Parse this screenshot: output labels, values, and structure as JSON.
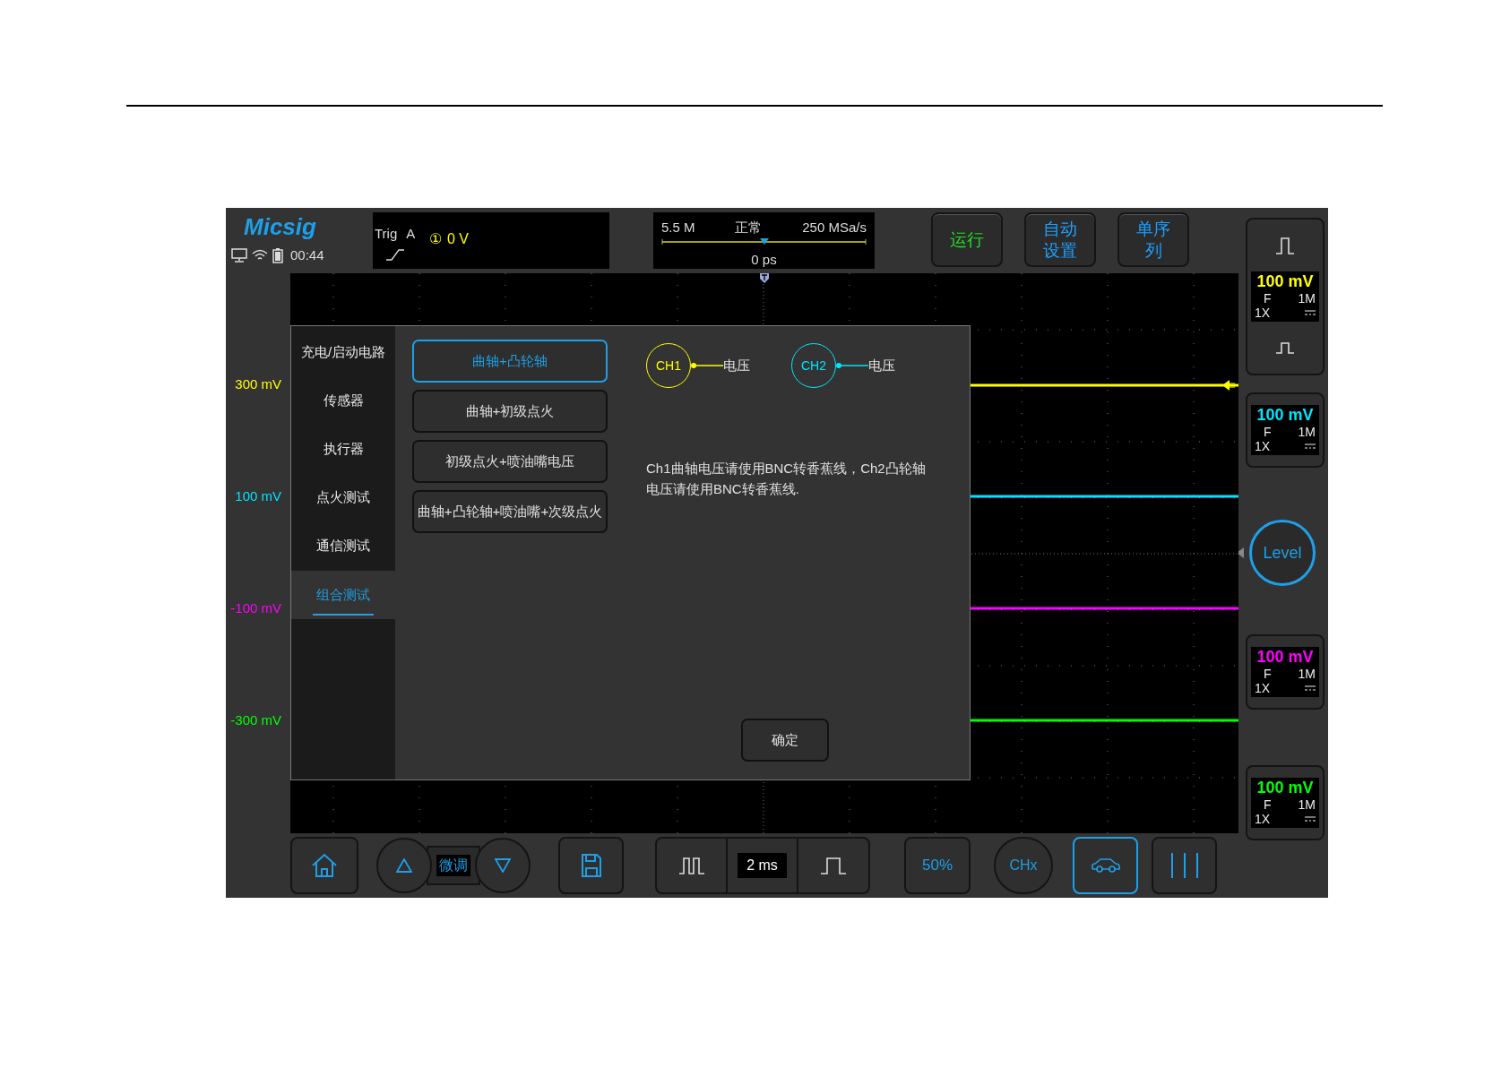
{
  "status": {
    "logo": "Micsig",
    "time": "00:44"
  },
  "trigger": {
    "label": "Trig",
    "source": "A",
    "channel_symbol": "①",
    "value": "0 V"
  },
  "timebase": {
    "memory": "5.5 M",
    "mode": "正常",
    "sample_rate": "250 MSa/s",
    "offset": "0 ps"
  },
  "top_buttons": [
    {
      "label": "运行",
      "color": "#22dd22"
    },
    {
      "label": "自动设置",
      "color": "#1ea0ff"
    },
    {
      "label": "单序列",
      "color": "#1ea0ff"
    }
  ],
  "channels": [
    {
      "offset_label": "300 mV",
      "color": "#ffff00",
      "scale": "100 mV",
      "coupling": "F",
      "impedance": "1M",
      "probe": "1X"
    },
    {
      "offset_label": "100 mV",
      "color": "#00e5ff",
      "scale": "100 mV",
      "coupling": "F",
      "impedance": "1M",
      "probe": "1X"
    },
    {
      "offset_label": "-100 mV",
      "color": "#ff00ff",
      "scale": "100 mV",
      "coupling": "F",
      "impedance": "1M",
      "probe": "1X"
    },
    {
      "offset_label": "-300 mV",
      "color": "#00ff00",
      "scale": "100 mV",
      "coupling": "F",
      "impedance": "1M",
      "probe": "1X"
    }
  ],
  "level_button": "Level",
  "dialog": {
    "categories": [
      {
        "label": "充电/启动电路",
        "selected": false
      },
      {
        "label": "传感器",
        "selected": false
      },
      {
        "label": "执行器",
        "selected": false
      },
      {
        "label": "点火测试",
        "selected": false
      },
      {
        "label": "通信测试",
        "selected": false
      },
      {
        "label": "组合测试",
        "selected": true
      }
    ],
    "tests": [
      {
        "label": "曲轴+凸轮轴",
        "selected": true
      },
      {
        "label": "曲轴+初级点火",
        "selected": false
      },
      {
        "label": "初级点火+喷油嘴电压",
        "selected": false
      },
      {
        "label": "曲轴+凸轮轴+喷油嘴+次级点火",
        "selected": false
      }
    ],
    "probes": [
      {
        "channel": "CH1",
        "color": "#ffff00",
        "signal": "电压"
      },
      {
        "channel": "CH2",
        "color": "#00e5ff",
        "signal": "电压"
      }
    ],
    "note": "Ch1曲轴电压请使用BNC转香蕉线，Ch2凸轮轴电压请使用BNC转香蕉线.",
    "confirm": "确定"
  },
  "toolbar": {
    "fine_tune": "微调",
    "time_scale": "2 ms",
    "percent": "50%",
    "channel_button": "CHx",
    "car_selected": true
  }
}
